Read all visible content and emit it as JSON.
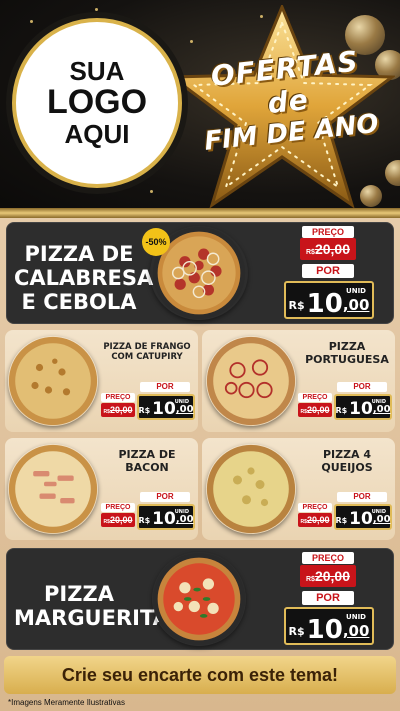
{
  "logo": {
    "line1": "SUA",
    "line2": "LOGO",
    "line3": "AQUI"
  },
  "banner": {
    "line1": "OFERTAS de",
    "line2": "FIM DE ANO"
  },
  "featured_top": {
    "name_line1": "PIZZA DE",
    "name_line2": "CALABRESA",
    "name_line3": "E CEBOLA",
    "badge": "-50%",
    "old_label": "PREÇO",
    "old_currency": "R$",
    "old_price": "20,00",
    "new_label": "POR",
    "currency": "R$",
    "price_int": "10",
    "price_dec": ",00",
    "unit": "UNID"
  },
  "items": [
    {
      "name_line1": "PIZZA DE FRANGO",
      "name_line2": "COM CATUPIRY",
      "old_label": "PREÇO",
      "old_currency": "R$",
      "old_price": "20,00",
      "new_label": "POR",
      "currency": "R$",
      "price_int": "10",
      "price_dec": ",00",
      "unit": "UNID"
    },
    {
      "name_line1": "PIZZA",
      "name_line2": "PORTUGUESA",
      "old_label": "PREÇO",
      "old_currency": "R$",
      "old_price": "20,00",
      "new_label": "POR",
      "currency": "R$",
      "price_int": "10",
      "price_dec": ",00",
      "unit": "UNID"
    },
    {
      "name_line1": "PIZZA DE",
      "name_line2": "BACON",
      "old_label": "PREÇO",
      "old_currency": "R$",
      "old_price": "20,00",
      "new_label": "POR",
      "currency": "R$",
      "price_int": "10",
      "price_dec": ",00",
      "unit": "UNID"
    },
    {
      "name_line1": "PIZZA 4",
      "name_line2": "QUEIJOS",
      "old_label": "PREÇO",
      "old_currency": "R$",
      "old_price": "20,00",
      "new_label": "POR",
      "currency": "R$",
      "price_int": "10",
      "price_dec": ",00",
      "unit": "UNID"
    }
  ],
  "featured_bottom": {
    "name_line1": "PIZZA",
    "name_line2": "MARGUERITA",
    "old_label": "PREÇO",
    "old_currency": "R$",
    "old_price": "20,00",
    "new_label": "POR",
    "currency": "R$",
    "price_int": "10",
    "price_dec": ",00",
    "unit": "UNID"
  },
  "footer": {
    "cta": "Crie seu encarte com este tema!",
    "disclaimer": "*Imagens Meramente Ilustrativas"
  },
  "colors": {
    "accent_red": "#c8141a",
    "gold": "#e0bb58",
    "dark_panel": "#2d2d2d",
    "cream_panel": "#f3e4cc"
  }
}
